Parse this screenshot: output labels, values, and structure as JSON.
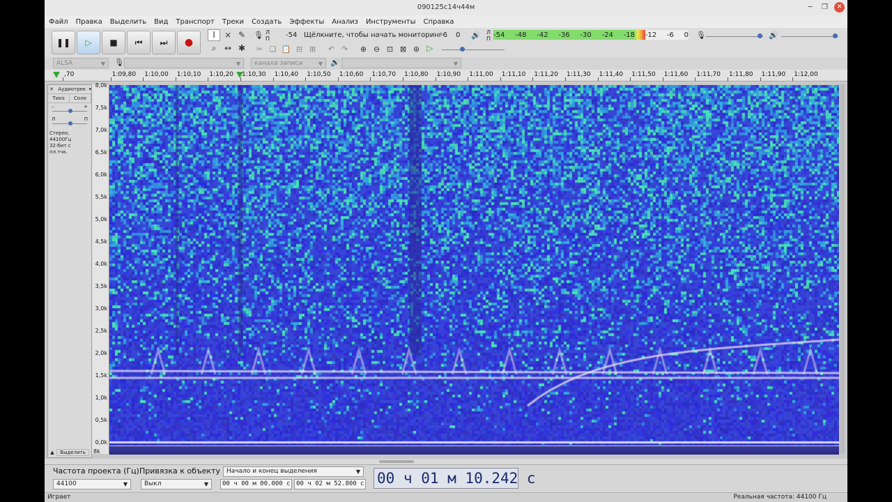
{
  "window": {
    "title": "090125с14ч44м"
  },
  "menu": [
    "Файл",
    "Правка",
    "Выделить",
    "Вид",
    "Транспорт",
    "Треки",
    "Создать",
    "Эффекты",
    "Анализ",
    "Инструменты",
    "Справка"
  ],
  "recording_meter": {
    "channels_l": "Л",
    "channels_r": "П",
    "db_left": "-54",
    "hint": "Щёлкните, чтобы начать мониторинг",
    "db_right": "-6",
    "db_zero": "0"
  },
  "playback_meter": {
    "ticks": [
      "-54",
      "-48",
      "-42",
      "-36",
      "-30",
      "-24",
      "-18",
      "-12",
      "-6",
      "0"
    ],
    "level_fraction": 0.78
  },
  "device": {
    "host": "ALSA",
    "channels": "канала записи (стерео)"
  },
  "ruler": {
    "ticks": [
      "1:09,70",
      "1:09,80",
      "1:10,00",
      "1:10,10",
      "1:10,20",
      "1:10,30",
      "1:10,40",
      "1:10,50",
      "1:10,60",
      "1:10,70",
      "1:10,80",
      "1:10,90",
      "1:11,00",
      "1:11,10",
      "1:11,20",
      "1:11,30",
      "1:11,40",
      "1:11,50",
      "1:11,60",
      "1:11,70",
      "1:11,80",
      "1:11,90",
      "1:12,00"
    ],
    "tick_first_label": ",70"
  },
  "track": {
    "name": "Аудиотрек",
    "mute": "Тихо",
    "solo": "Соло",
    "gain_minus": "–",
    "gain_plus": "+",
    "pan_left": "Л",
    "pan_right": "П",
    "info_line1": "Стерео, 44100Гц",
    "info_line2": "32-бит с пл.тчк.",
    "select": "Выделить",
    "gain_level": 0.5,
    "pan_level": 0.5
  },
  "freq_axis": {
    "labels": [
      "8,0k",
      "7,5k",
      "7,0k",
      "6,5k",
      "6,0k",
      "5,5k",
      "5,0k",
      "4,5k",
      "4,0k",
      "3,5k",
      "3,0k",
      "2,5k",
      "2,0k",
      "1,5k",
      "1,0k",
      "0,5k",
      "0,0k"
    ],
    "bottom": "8k"
  },
  "selection_toolbar": {
    "rate_label": "Частота проекта (Гц)",
    "snap_label": "Привязка к объекту",
    "rate_value": "44100",
    "snap_value": "Выкл",
    "mode": "Начало и конец выделения",
    "start": "00 ч 00 м 00.000 с",
    "end": "00 ч 02 м 52.800 с",
    "position": "00 ч 01 м 10.242 с"
  },
  "status": {
    "left": "Играет",
    "right": "Реальная частота: 44100 Гц"
  },
  "colors": {
    "spectrogram_bg": "#3b3bd6",
    "spectrogram_hot": "#4fd0b0",
    "tone_line": "#e8e0f0",
    "play_green": "#35a835",
    "record_red": "#cc1111"
  }
}
